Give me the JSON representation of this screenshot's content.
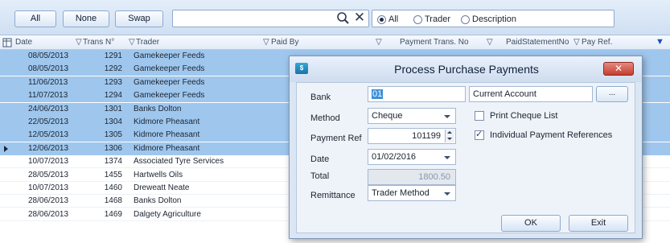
{
  "toolbar": {
    "all_label": "All",
    "none_label": "None",
    "swap_label": "Swap",
    "search_value": "",
    "filter_options": [
      {
        "label": "All",
        "selected": true
      },
      {
        "label": "Trader",
        "selected": false
      },
      {
        "label": "Description",
        "selected": false
      }
    ]
  },
  "grid": {
    "columns": {
      "date": "Date",
      "trans_no": "Trans N°",
      "trader": "Trader",
      "paid_by": "Paid By",
      "payment_trans_no": "Payment Trans. No",
      "paid_statement_no": "PaidStatementNo",
      "pay_ref": "Pay Ref."
    },
    "rows": [
      {
        "date": "08/05/2013",
        "trans": "1291",
        "trader": "Gamekeeper Feeds",
        "selected": true
      },
      {
        "date": "08/05/2013",
        "trans": "1292",
        "trader": "Gamekeeper Feeds",
        "selected": true
      },
      {
        "date": "11/06/2013",
        "trans": "1293",
        "trader": "Gamekeeper Feeds",
        "selected": true
      },
      {
        "date": "11/07/2013",
        "trans": "1294",
        "trader": "Gamekeeper Feeds",
        "selected": true
      },
      {
        "date": "24/06/2013",
        "trans": "1301",
        "trader": "Banks Dolton",
        "selected": true
      },
      {
        "date": "22/05/2013",
        "trans": "1304",
        "trader": "Kidmore Pheasant",
        "selected": true
      },
      {
        "date": "12/05/2013",
        "trans": "1305",
        "trader": "Kidmore Pheasant",
        "selected": true
      },
      {
        "date": "12/06/2013",
        "trans": "1306",
        "trader": "Kidmore Pheasant",
        "selected": true,
        "current": true
      },
      {
        "date": "10/07/2013",
        "trans": "1374",
        "trader": "Associated Tyre Services",
        "selected": false
      },
      {
        "date": "28/05/2013",
        "trans": "1455",
        "trader": "Hartwells Oils",
        "selected": false
      },
      {
        "date": "10/07/2013",
        "trans": "1460",
        "trader": "Dreweatt Neate",
        "selected": false
      },
      {
        "date": "28/06/2013",
        "trans": "1468",
        "trader": "Banks Dolton",
        "selected": false
      },
      {
        "date": "28/06/2013",
        "trans": "1469",
        "trader": "Dalgety Agriculture",
        "selected": false
      }
    ]
  },
  "dialog": {
    "title": "Process Purchase Payments",
    "close_label": "✕",
    "bank_label": "Bank",
    "bank_value": "01",
    "bank_name": "Current Account",
    "browse_label": "...",
    "method_label": "Method",
    "method_value": "Cheque",
    "print_cheque_label": "Print Cheque List",
    "print_cheque_checked": false,
    "payment_ref_label": "Payment Ref",
    "payment_ref_value": "101199",
    "individual_refs_label": "Individual Payment References",
    "individual_refs_checked": true,
    "date_label": "Date",
    "date_value": "01/02/2016",
    "total_label": "Total",
    "total_value": "1800.50",
    "remittance_label": "Remittance",
    "remittance_value": "Trader Method",
    "ok_label": "OK",
    "exit_label": "Exit"
  },
  "colors": {
    "selected_row": "#9fc7ee",
    "close_button": "#c53f30",
    "dialog_bg": "#dbe6f4"
  }
}
